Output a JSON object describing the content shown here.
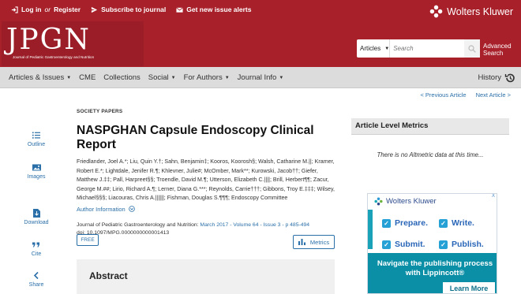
{
  "header": {
    "login_label": "Log in",
    "or_label": "or",
    "register_label": "Register",
    "subscribe_label": "Subscribe to journal",
    "alerts_label": "Get new issue alerts",
    "brand": "Wolters Kluwer",
    "logo_text": "JPGN",
    "logo_subtitle": "Journal of Pediatric Gastroenterology and Nutrition",
    "search_type": "Articles",
    "search_placeholder": "Search",
    "advanced_search": [
      "Advanced",
      "Search"
    ]
  },
  "nav": {
    "items": [
      "Articles & Issues",
      "CME",
      "Collections",
      "Social",
      "For Authors",
      "Journal Info"
    ],
    "history_label": "History"
  },
  "pager": {
    "prev_label": "< Previous Article",
    "next_label": "Next Article >"
  },
  "tools": [
    {
      "label": "Outline",
      "icon": "list-icon"
    },
    {
      "label": "Images",
      "icon": "image-icon"
    },
    {
      "label": "Download",
      "icon": "download-icon"
    },
    {
      "label": "Cite",
      "icon": "quote-icon"
    },
    {
      "label": "Share",
      "icon": "share-icon"
    }
  ],
  "article": {
    "section": "SOCIETY PAPERS",
    "title": "NASPGHAN Capsule Endoscopy Clinical Report",
    "authors": "Friedlander, Joel A.*; Liu, Quin Y.†; Sahn, Benjamin‡; Kooros, Koorosh§; Walsh, Catharine M.||; Kramer, Robert E.*; Lightdale, Jenifer R.¶; Khlevner, Julie#; McOmber, Mark**; Kurowski, Jacob††; Giefer, Matthew J.‡‡; Pall, Harpreet§§; Troendle, David M.¶; Utterson, Elizabeth C.||||; Brill, Herbert¶¶; Zacur, George M.##; Lirio, Richard A.¶; Lerner, Diana G.***; Reynolds, Carrie†††; Gibbons, Troy E.‡‡‡; Wilsey, Michael§§§; Liacouras, Chris A.||||||; Fishman, Douglas S.¶¶¶; Endoscopy Committee",
    "author_info_label": "Author Information",
    "journal": "Journal of Pediatric Gastroenterology and Nutrition:",
    "issue": "March 2017 - Volume 64 - Issue 3 - p 485-494",
    "doi": "doi: 10.1097/MPG.0000000000001413",
    "free_label": "FREE",
    "metrics_label": "Metrics",
    "abstract_heading": "Abstract"
  },
  "sidebar": {
    "metrics_heading": "Article Level Metrics",
    "altmetric_text": "There is no Altmetric data at this time...",
    "ad": {
      "close": "X",
      "brand": "Wolters Kluwer",
      "words": [
        "Prepare.",
        "Write.",
        "Submit.",
        "Publish."
      ],
      "cta": "Navigate the publishing process with Lippincott®",
      "button": "Learn More"
    }
  },
  "colors": {
    "brand_red": "#a8202a",
    "link_blue": "#2a6fa8",
    "ad_teal": "#0a8fa6"
  }
}
